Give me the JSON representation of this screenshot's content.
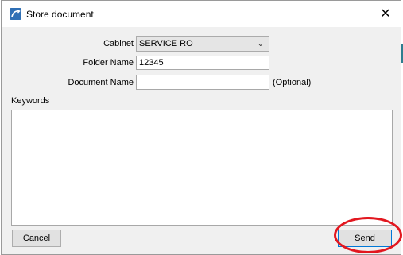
{
  "window": {
    "title": "Store document",
    "close_glyph": "✕"
  },
  "form": {
    "cabinet_label": "Cabinet",
    "cabinet_value": "SERVICE RO",
    "folder_label": "Folder Name",
    "folder_value": "12345",
    "document_label": "Document Name",
    "document_value": "",
    "document_hint": "(Optional)",
    "keywords_label": "Keywords",
    "keywords_value": ""
  },
  "buttons": {
    "cancel_label": "Cancel",
    "send_label": "Send"
  },
  "annotation": {
    "highlight_color": "#e2171f"
  },
  "icons": {
    "app": "store-document-icon",
    "dropdown": "chevron-down-icon",
    "close": "close-icon"
  }
}
